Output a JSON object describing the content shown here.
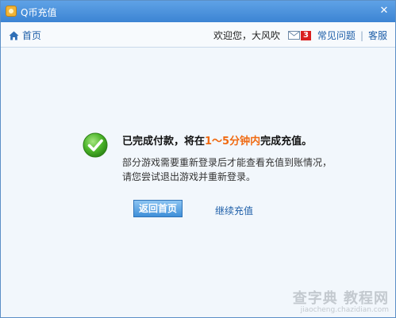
{
  "window": {
    "title": "Q币充值"
  },
  "navbar": {
    "home_label": "首页",
    "welcome": "欢迎您，大风吹",
    "mail_count": "3",
    "faq_label": "常见问题",
    "separator": "|",
    "service_label": "客服"
  },
  "message": {
    "title_prefix": "已完成付款，将在",
    "title_highlight": "1～5分钟内",
    "title_suffix": "完成充值。",
    "line1": "部分游戏需要重新登录后才能查看充值到账情况，",
    "line2": "请您尝试退出游戏并重新登录。"
  },
  "actions": {
    "back_home_label": "返回首页",
    "continue_label": "继续充值"
  },
  "watermark": {
    "main": "查字典 教程网",
    "sub": "jiaocheng.chazidian.com"
  },
  "colors": {
    "titlebar": "#4a92dd",
    "link": "#1d5ea8",
    "highlight": "#f06a12",
    "success": "#4cb52a"
  },
  "icons": {
    "title": "coin-bag-icon",
    "close": "close-icon",
    "home": "home-icon",
    "mail": "mail-icon",
    "status": "check-circle-icon"
  }
}
